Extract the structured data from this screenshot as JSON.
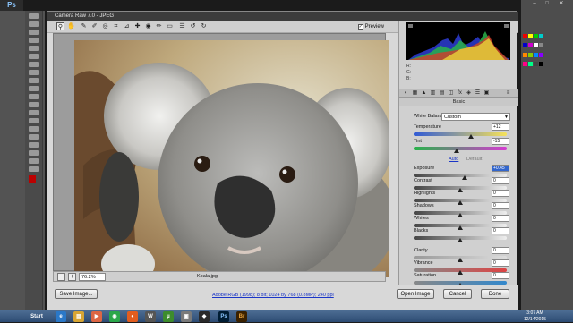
{
  "ps": {
    "logo": "Ps"
  },
  "dialog": {
    "title": "Camera Raw 7.0 - JPEG",
    "preview_label": "Preview",
    "zoom_value": "76.2%",
    "file_name": "Koala.jpg",
    "color_info": "Adobe RGB (1998); 8 bit; 1024 by 768 (0.8MP); 240 ppi",
    "buttons": {
      "save": "Save Image...",
      "open": "Open Image",
      "cancel": "Cancel",
      "done": "Done"
    }
  },
  "panel": {
    "rgb": [
      "R:",
      "G:",
      "B:"
    ],
    "section": "Basic",
    "white_balance": {
      "label": "White Balance:",
      "value": "Custom"
    },
    "auto": "Auto",
    "default": "Default",
    "sliders": [
      {
        "label": "Temperature",
        "value": "+12",
        "level": 0.62
      },
      {
        "label": "Tint",
        "value": "-15",
        "level": 0.46
      },
      {
        "label": "Exposure",
        "value": "+0.45",
        "level": 0.55,
        "highlight": true
      },
      {
        "label": "Contrast",
        "value": "0",
        "level": 0.5
      },
      {
        "label": "Highlights",
        "value": "0",
        "level": 0.5
      },
      {
        "label": "Shadows",
        "value": "0",
        "level": 0.5
      },
      {
        "label": "Whites",
        "value": "0",
        "level": 0.5
      },
      {
        "label": "Blacks",
        "value": "0",
        "level": 0.5
      },
      {
        "label": "Clarity",
        "value": "0",
        "level": 0.5
      },
      {
        "label": "Vibrance",
        "value": "0",
        "level": 0.5
      },
      {
        "label": "Saturation",
        "value": "0",
        "level": 0.5
      }
    ]
  },
  "taskbar": {
    "start": "Start",
    "time": "3:07 AM",
    "date": "12/14/2015",
    "br": "Br",
    "ps": "Ps"
  },
  "colors": {
    "accent": "#3366cc",
    "link": "#1a35c7",
    "title_bg": "#3c3c3c"
  }
}
